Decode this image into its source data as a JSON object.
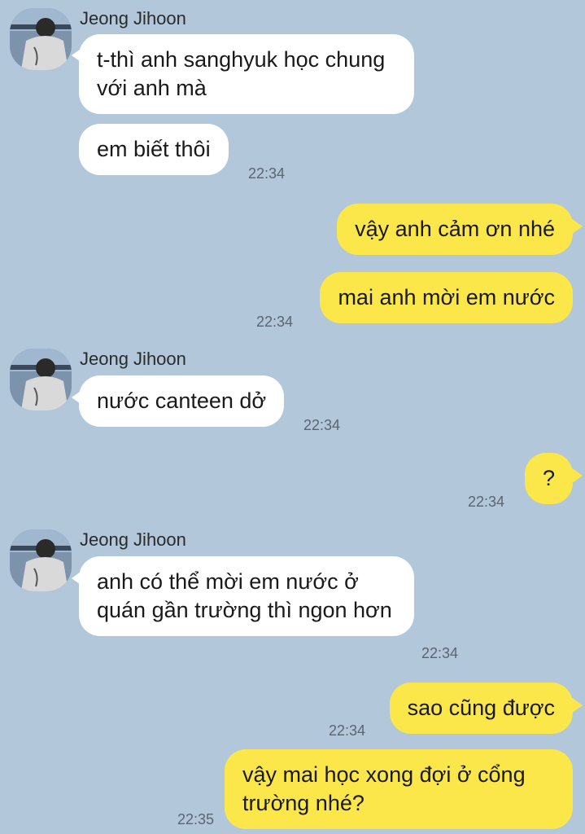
{
  "chat": {
    "sender_name": "Jeong Jihoon",
    "messages": [
      {
        "text": "t-thì anh sanghyuk học chung với anh mà",
        "time": ""
      },
      {
        "text": "em biết thôi",
        "time": "22:34"
      },
      {
        "text": "vậy anh cảm ơn nhé",
        "time": ""
      },
      {
        "text": "mai anh mời em nước",
        "time": "22:34"
      },
      {
        "text": "nước canteen dở",
        "time": "22:34"
      },
      {
        "text": "?",
        "time": "22:34"
      },
      {
        "text": "anh có thể mời em nước ở quán gần trường thì ngon hơn",
        "time": "22:34"
      },
      {
        "text": "sao cũng được",
        "time": "22:34"
      },
      {
        "text": "vậy mai học xong đợi ở cổng trường nhé?",
        "time": "22:35"
      }
    ]
  },
  "colors": {
    "background": "#b2c7da",
    "incoming_bubble": "#ffffff",
    "outgoing_bubble": "#fbe74a"
  }
}
